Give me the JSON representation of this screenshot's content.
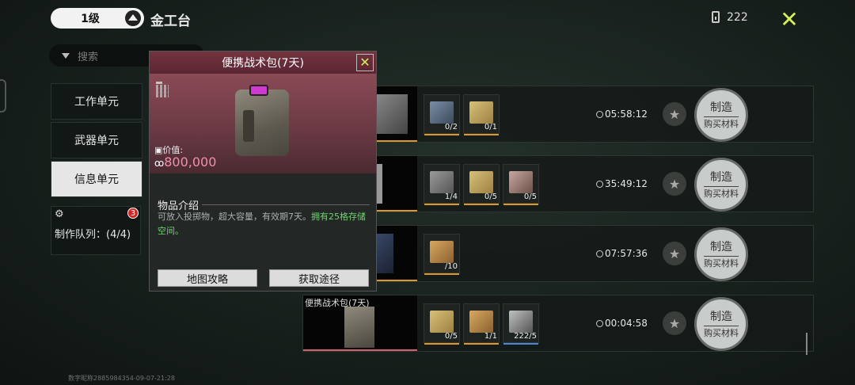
{
  "header": {
    "level": "1级",
    "workbench": "金工台",
    "currency_icon": "battery-icon",
    "currency": "222"
  },
  "search": {
    "placeholder": "搜索"
  },
  "tabs": [
    {
      "label": "工作单元"
    },
    {
      "label": "武器单元"
    },
    {
      "label": "信息单元",
      "active": true
    }
  ],
  "queue": {
    "badge": "3",
    "label": "制作队列：(4/4)"
  },
  "rows": [
    {
      "name": "",
      "materials": [
        {
          "count": "0/2"
        },
        {
          "count": "0/1"
        }
      ],
      "timer": "05:58:12"
    },
    {
      "name": "",
      "materials": [
        {
          "count": "1/4"
        },
        {
          "count": "0/5"
        },
        {
          "count": "0/5"
        }
      ],
      "timer": "35:49:12"
    },
    {
      "name": "",
      "materials": [
        {
          "count": "/10"
        }
      ],
      "timer": "07:57:36"
    },
    {
      "name": "便携战术包(7天)",
      "materials": [
        {
          "count": "0/5"
        },
        {
          "count": "1/1"
        },
        {
          "count": "222/5"
        }
      ],
      "timer": "00:04:58"
    }
  ],
  "craft": {
    "label": "制造",
    "sub": "购买材料"
  },
  "popup": {
    "title": "便携战术包(7天)",
    "price_label": "价值:",
    "price": "800,000",
    "intro_title": "物品介绍",
    "intro_text": "可放入投掷物，超大容量，有效期7天。",
    "intro_highlight": "拥有25格存储空间。",
    "btn_map": "地图攻略",
    "btn_obtain": "获取途径"
  },
  "watermark": "数字昵称2885984354-09-07-21:28",
  "colors": {
    "accent": "#d8f058",
    "price": "#f08fa8",
    "highlight": "#6fd26f",
    "bar": "#d99a2b"
  }
}
